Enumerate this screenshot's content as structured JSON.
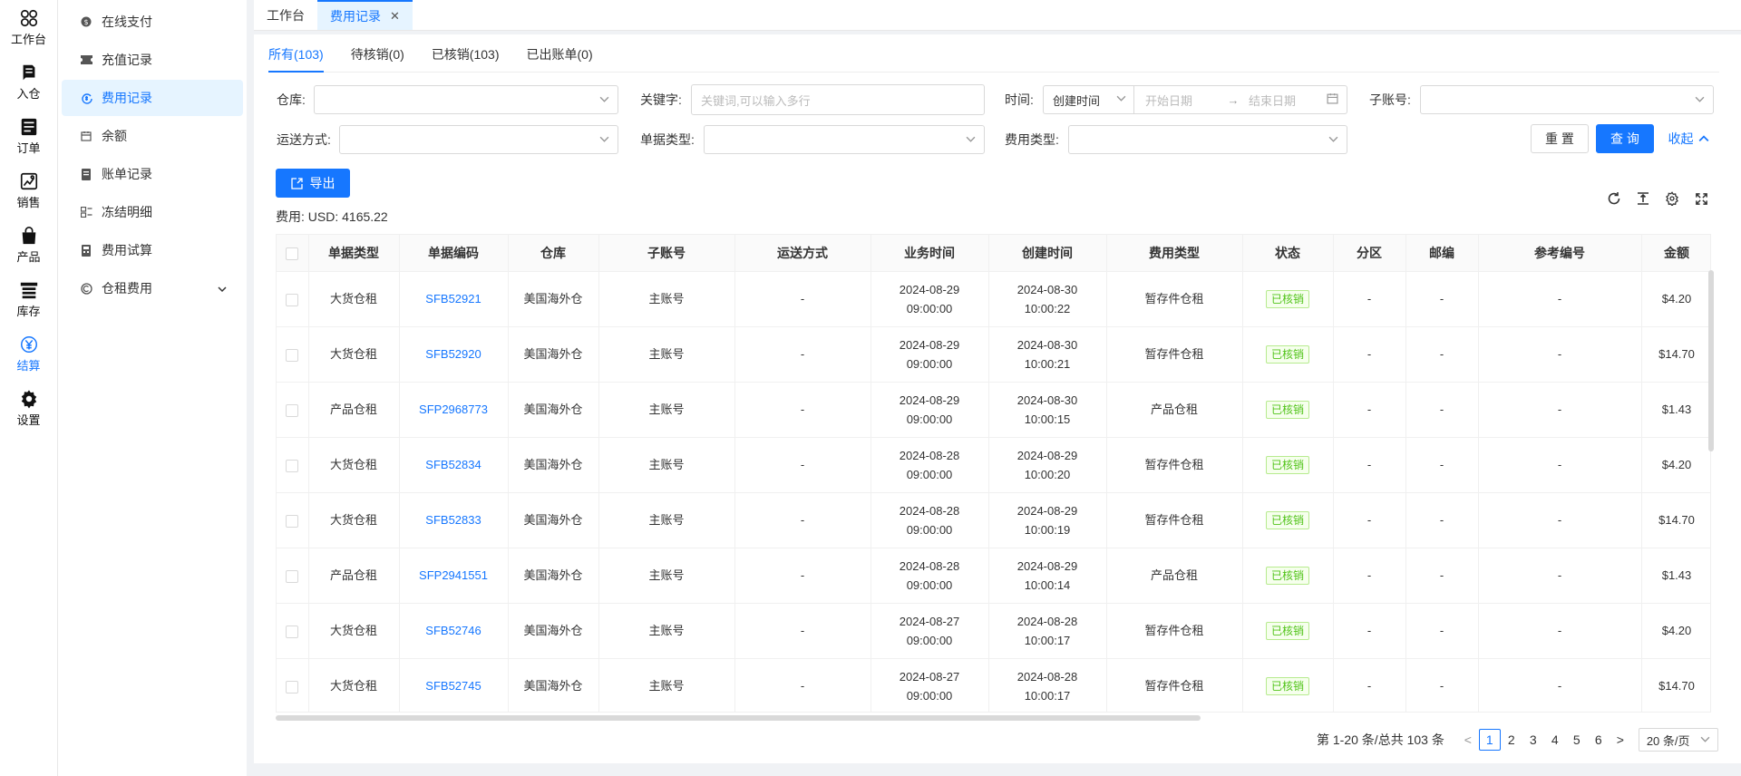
{
  "rail": [
    {
      "label": "工作台",
      "icon": "workspace-icon"
    },
    {
      "label": "入仓",
      "icon": "inbound-icon"
    },
    {
      "label": "订单",
      "icon": "order-icon"
    },
    {
      "label": "销售",
      "icon": "sales-icon"
    },
    {
      "label": "产品",
      "icon": "product-icon"
    },
    {
      "label": "库存",
      "icon": "inventory-icon"
    },
    {
      "label": "结算",
      "icon": "settlement-icon",
      "active": true
    },
    {
      "label": "设置",
      "icon": "settings-icon"
    }
  ],
  "submenu": [
    {
      "label": "在线支付",
      "icon": "payment-icon"
    },
    {
      "label": "充值记录",
      "icon": "ticket-icon"
    },
    {
      "label": "费用记录",
      "icon": "fee-icon",
      "active": true
    },
    {
      "label": "余额",
      "icon": "calendar-icon"
    },
    {
      "label": "账单记录",
      "icon": "bill-icon"
    },
    {
      "label": "冻结明细",
      "icon": "frozen-icon"
    },
    {
      "label": "费用试算",
      "icon": "calculator-icon"
    },
    {
      "label": "仓租费用",
      "icon": "rent-icon",
      "expandable": true
    }
  ],
  "page_tabs": [
    {
      "label": "工作台"
    },
    {
      "label": "费用记录",
      "active": true,
      "closable": true
    }
  ],
  "filter_tabs": [
    {
      "label": "所有(103)",
      "active": true
    },
    {
      "label": "待核销(0)"
    },
    {
      "label": "已核销(103)"
    },
    {
      "label": "已出账单(0)"
    }
  ],
  "filters": {
    "warehouse_label": "仓库:",
    "keyword_label": "关键字:",
    "keyword_placeholder": "关键词,可以输入多行",
    "time_label": "时间:",
    "time_type_value": "创建时间",
    "start_date_placeholder": "开始日期",
    "end_date_placeholder": "结束日期",
    "sub_account_label": "子账号:",
    "shipping_label": "运送方式:",
    "doc_type_label": "单据类型:",
    "fee_type_label": "费用类型:"
  },
  "actions": {
    "reset": "重 置",
    "query": "查 询",
    "collapse": "收起",
    "export": "导出"
  },
  "fee_total": "费用: USD: 4165.22",
  "table": {
    "columns": [
      "单据类型",
      "单据编码",
      "仓库",
      "子账号",
      "运送方式",
      "业务时间",
      "创建时间",
      "费用类型",
      "状态",
      "分区",
      "邮编",
      "参考编号",
      "金额"
    ],
    "rows": [
      {
        "doc_type": "大货仓租",
        "doc_code": "SFB52921",
        "warehouse": "美国海外仓",
        "sub_account": "主账号",
        "shipping": "-",
        "biz_date": "2024-08-29",
        "biz_time": "09:00:00",
        "created_date": "2024-08-30",
        "created_time": "10:00:22",
        "fee_type": "暂存件仓租",
        "status": "已核销",
        "zone": "-",
        "zip": "-",
        "ref": "-",
        "amount": "$4.20"
      },
      {
        "doc_type": "大货仓租",
        "doc_code": "SFB52920",
        "warehouse": "美国海外仓",
        "sub_account": "主账号",
        "shipping": "-",
        "biz_date": "2024-08-29",
        "biz_time": "09:00:00",
        "created_date": "2024-08-30",
        "created_time": "10:00:21",
        "fee_type": "暂存件仓租",
        "status": "已核销",
        "zone": "-",
        "zip": "-",
        "ref": "-",
        "amount": "$14.70"
      },
      {
        "doc_type": "产品仓租",
        "doc_code": "SFP2968773",
        "warehouse": "美国海外仓",
        "sub_account": "主账号",
        "shipping": "-",
        "biz_date": "2024-08-29",
        "biz_time": "09:00:00",
        "created_date": "2024-08-30",
        "created_time": "10:00:15",
        "fee_type": "产品仓租",
        "status": "已核销",
        "zone": "-",
        "zip": "-",
        "ref": "-",
        "amount": "$1.43"
      },
      {
        "doc_type": "大货仓租",
        "doc_code": "SFB52834",
        "warehouse": "美国海外仓",
        "sub_account": "主账号",
        "shipping": "-",
        "biz_date": "2024-08-28",
        "biz_time": "09:00:00",
        "created_date": "2024-08-29",
        "created_time": "10:00:20",
        "fee_type": "暂存件仓租",
        "status": "已核销",
        "zone": "-",
        "zip": "-",
        "ref": "-",
        "amount": "$4.20"
      },
      {
        "doc_type": "大货仓租",
        "doc_code": "SFB52833",
        "warehouse": "美国海外仓",
        "sub_account": "主账号",
        "shipping": "-",
        "biz_date": "2024-08-28",
        "biz_time": "09:00:00",
        "created_date": "2024-08-29",
        "created_time": "10:00:19",
        "fee_type": "暂存件仓租",
        "status": "已核销",
        "zone": "-",
        "zip": "-",
        "ref": "-",
        "amount": "$14.70"
      },
      {
        "doc_type": "产品仓租",
        "doc_code": "SFP2941551",
        "warehouse": "美国海外仓",
        "sub_account": "主账号",
        "shipping": "-",
        "biz_date": "2024-08-28",
        "biz_time": "09:00:00",
        "created_date": "2024-08-29",
        "created_time": "10:00:14",
        "fee_type": "产品仓租",
        "status": "已核销",
        "zone": "-",
        "zip": "-",
        "ref": "-",
        "amount": "$1.43"
      },
      {
        "doc_type": "大货仓租",
        "doc_code": "SFB52746",
        "warehouse": "美国海外仓",
        "sub_account": "主账号",
        "shipping": "-",
        "biz_date": "2024-08-27",
        "biz_time": "09:00:00",
        "created_date": "2024-08-28",
        "created_time": "10:00:17",
        "fee_type": "暂存件仓租",
        "status": "已核销",
        "zone": "-",
        "zip": "-",
        "ref": "-",
        "amount": "$4.20"
      },
      {
        "doc_type": "大货仓租",
        "doc_code": "SFB52745",
        "warehouse": "美国海外仓",
        "sub_account": "主账号",
        "shipping": "-",
        "biz_date": "2024-08-27",
        "biz_time": "09:00:00",
        "created_date": "2024-08-28",
        "created_time": "10:00:17",
        "fee_type": "暂存件仓租",
        "status": "已核销",
        "zone": "-",
        "zip": "-",
        "ref": "-",
        "amount": "$14.70"
      }
    ]
  },
  "pagination": {
    "summary": "第 1-20 条/总共 103 条",
    "prev": "<",
    "next": ">",
    "pages": [
      "1",
      "2",
      "3",
      "4",
      "5",
      "6"
    ],
    "current": "1",
    "page_size": "20 条/页"
  },
  "colors": {
    "accent": "#1677ff",
    "success_tag": "#52c41a"
  }
}
